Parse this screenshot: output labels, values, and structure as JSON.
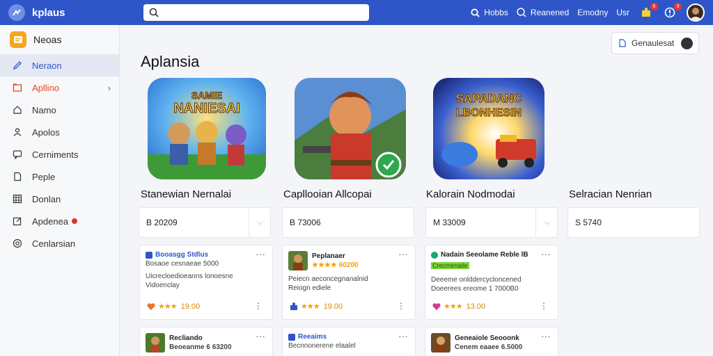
{
  "topbar": {
    "brand": "kplaus",
    "search_placeholder": "",
    "actions": [
      {
        "label": "Hobbs",
        "icon": "search-icon"
      },
      {
        "label": "Reanened",
        "icon": "magnifier-icon"
      },
      {
        "label": "Emodny",
        "icon": ""
      },
      {
        "label": "Usr",
        "icon": ""
      }
    ],
    "notif_count": "6",
    "alert_count": "3"
  },
  "sidebar": {
    "header": "Neoas",
    "items": [
      {
        "label": "Neraon",
        "icon": "pencil-icon"
      },
      {
        "label": "Apllino",
        "icon": "folder-icon"
      },
      {
        "label": "Namo",
        "icon": "home-icon"
      },
      {
        "label": "Apolos",
        "icon": "person-icon"
      },
      {
        "label": "Cerniments",
        "icon": "comment-icon"
      },
      {
        "label": "Peple",
        "icon": "document-icon"
      },
      {
        "label": "Donlan",
        "icon": "grid-icon"
      },
      {
        "label": "Apdenea",
        "icon": "edit-icon"
      },
      {
        "label": "Cenlarsian",
        "icon": "settings-icon"
      }
    ]
  },
  "main": {
    "cta_label": "Genaulesat",
    "title": "Aplansia",
    "games": [
      {
        "title": "Stanewian Nernalai",
        "price": "B 20209",
        "art_text_1": "SAMIE",
        "art_text_2": "NANIESAI",
        "has_dropdown": true
      },
      {
        "title": "Capllooian Allcopai",
        "price": "B 73006",
        "art_text_1": "",
        "art_text_2": "",
        "has_dropdown": false
      },
      {
        "title": "Kalorain Nodmodai",
        "price": "M 33009",
        "art_text_1": "SAPADANC",
        "art_text_2": "LBONHESIN",
        "has_dropdown": true
      },
      {
        "title": "Selracian Nenrian",
        "price": "S 5740",
        "art_text_1": "",
        "art_text_2": "",
        "has_dropdown": false
      }
    ],
    "list_cards": [
      {
        "title": "Booasgg Stdlus",
        "sub": "Bosaoe cesnaeae 5000",
        "desc1": "Uicrecloedioeanns lonoesne",
        "desc2": "Vidoenclay",
        "rating": "19.00",
        "icon_color": "#e8762a"
      },
      {
        "title": "Peplanaer",
        "sub": "★★★★ 60200",
        "desc1": "Peiecn aeconcegnanalnid",
        "desc2": "Reiogn ediele",
        "rating": "19.00",
        "icon_color": "#2f56c9"
      },
      {
        "title": "Nadain Seeolame Reble lB",
        "sub": "Crecmenaile",
        "desc1": "Deeeme onlddercycloncened",
        "desc2": "Doeerees ereome 1 7000B0",
        "rating": "13.00",
        "icon_color": "#d83a8f"
      },
      {
        "title": "Recliando",
        "sub": "Beoeanme 6 63200",
        "desc1": "",
        "desc2": "",
        "rating": "",
        "icon_color": ""
      },
      {
        "title": "Reeaims",
        "sub": "Becnnonerene elaalel",
        "desc1": "",
        "desc2": "",
        "rating": "",
        "icon_color": ""
      },
      {
        "title": "Geneaiole Seooonk",
        "sub": "Cenem eaaee 6.5000",
        "desc1": "",
        "desc2": "",
        "rating": "",
        "icon_color": ""
      }
    ]
  },
  "colors": {
    "brand": "#2f56c9",
    "accent_red": "#e2452b",
    "star": "#f2a20c"
  }
}
